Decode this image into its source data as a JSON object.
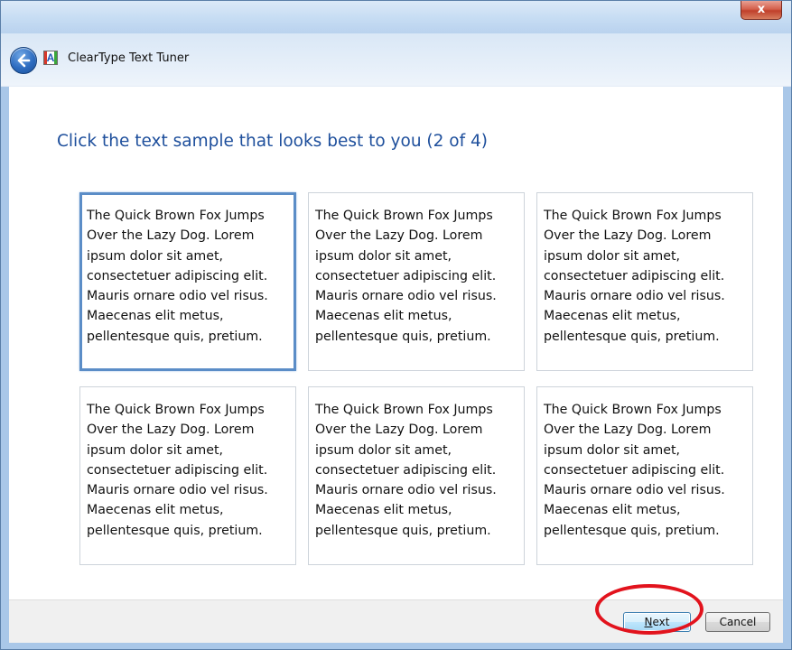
{
  "window": {
    "title": "ClearType Text Tuner",
    "close_glyph": "x",
    "back_icon": "back-arrow-icon",
    "app_icon": "cleartype-app-icon",
    "app_icon_letter": "A"
  },
  "main": {
    "instruction": "Click the text sample that looks best to you (2 of 4)",
    "samples": [
      {
        "text": "The Quick Brown Fox Jumps Over the Lazy Dog. Lorem ipsum dolor sit amet, consectetuer adipiscing elit. Mauris ornare odio vel risus. Maecenas elit metus, pellentesque quis, pretium.",
        "selected": true
      },
      {
        "text": "The Quick Brown Fox Jumps Over the Lazy Dog. Lorem ipsum dolor sit amet, consectetuer adipiscing elit. Mauris ornare odio vel risus. Maecenas elit metus, pellentesque quis, pretium.",
        "selected": false
      },
      {
        "text": "The Quick Brown Fox Jumps Over the Lazy Dog. Lorem ipsum dolor sit amet, consectetuer adipiscing elit. Mauris ornare odio vel risus. Maecenas elit metus, pellentesque quis, pretium.",
        "selected": false
      },
      {
        "text": "The Quick Brown Fox Jumps Over the Lazy Dog. Lorem ipsum dolor sit amet, consectetuer adipiscing elit. Mauris ornare odio vel risus. Maecenas elit metus, pellentesque quis, pretium.",
        "selected": false
      },
      {
        "text": "The Quick Brown Fox Jumps Over the Lazy Dog. Lorem ipsum dolor sit amet, consectetuer adipiscing elit. Mauris ornare odio vel risus. Maecenas elit metus, pellentesque quis, pretium.",
        "selected": false
      },
      {
        "text": "The Quick Brown Fox Jumps Over the Lazy Dog. Lorem ipsum dolor sit amet, consectetuer adipiscing elit. Mauris ornare odio vel risus. Maecenas elit metus, pellentesque quis, pretium.",
        "selected": false
      }
    ]
  },
  "footer": {
    "next_label_mnemonic": "N",
    "next_label_rest": "ext",
    "cancel_label": "Cancel"
  },
  "colors": {
    "instruction_text": "#1e4f9c",
    "selected_border": "#5b8dc7",
    "annotation_ellipse": "#e2131d"
  }
}
